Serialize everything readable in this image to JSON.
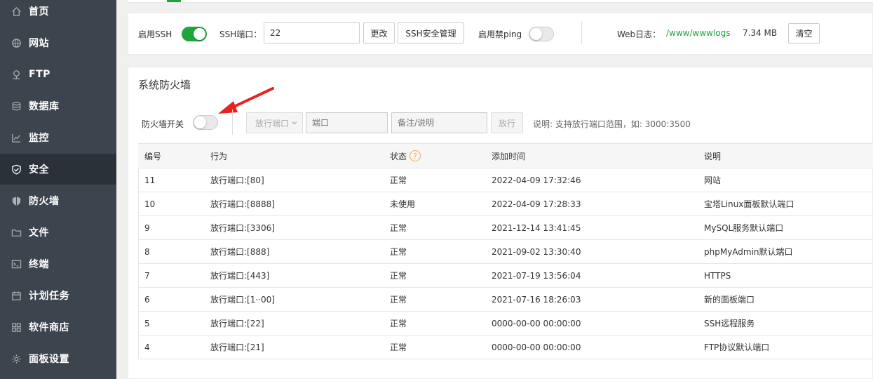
{
  "sidebar": {
    "items": [
      {
        "label": "首页",
        "icon": "home-icon"
      },
      {
        "label": "网站",
        "icon": "globe-icon"
      },
      {
        "label": "FTP",
        "icon": "ftp-icon"
      },
      {
        "label": "数据库",
        "icon": "database-icon"
      },
      {
        "label": "监控",
        "icon": "monitor-icon"
      },
      {
        "label": "安全",
        "icon": "shield-check-icon"
      },
      {
        "label": "防火墙",
        "icon": "shield-icon"
      },
      {
        "label": "文件",
        "icon": "folder-icon"
      },
      {
        "label": "终端",
        "icon": "terminal-icon"
      },
      {
        "label": "计划任务",
        "icon": "calendar-icon"
      },
      {
        "label": "软件商店",
        "icon": "grid-icon"
      },
      {
        "label": "面板设置",
        "icon": "gear-icon"
      }
    ],
    "active_index": 5
  },
  "ssh": {
    "enable_label": "启用SSH",
    "enabled": true,
    "port_label": "SSH端口：",
    "port_value": "22",
    "change_button": "更改",
    "manage_button": "SSH安全管理",
    "ping_label": "启用禁ping",
    "ping_enabled": false,
    "weblog_label": "Web日志：",
    "weblog_path": "/www/wwwlogs",
    "weblog_size": "7.34 MB",
    "clear_button": "清空"
  },
  "firewall": {
    "title": "系统防火墙",
    "switch_label": "防火墙开关",
    "switch_enabled": false,
    "select_value": "放行端口",
    "port_placeholder": "端口",
    "note_placeholder": "备注/说明",
    "allow_button": "放行",
    "hint": "说明: 支持放行端口范围，如: 3000:3500",
    "columns": [
      "编号",
      "行为",
      "状态",
      "添加时间",
      "说明"
    ],
    "rows": [
      {
        "id": "11",
        "action": "放行端口:[80]",
        "status": "正常",
        "time": "2022-04-09 17:32:46",
        "note": "网站"
      },
      {
        "id": "10",
        "action": "放行端口:[8888]",
        "status": "未使用",
        "time": "2022-04-09 17:28:33",
        "note": "宝塔Linux面板默认端口"
      },
      {
        "id": "9",
        "action": "放行端口:[3306]",
        "status": "正常",
        "time": "2021-12-14 13:41:45",
        "note": "MySQL服务默认端口"
      },
      {
        "id": "8",
        "action": "放行端口:[888]",
        "status": "正常",
        "time": "2021-09-02 13:30:40",
        "note": "phpMyAdmin默认端口"
      },
      {
        "id": "7",
        "action": "放行端口:[443]",
        "status": "正常",
        "time": "2021-07-19 13:56:04",
        "note": "HTTPS"
      },
      {
        "id": "6",
        "action": "放行端口:[1··00]",
        "status": "正常",
        "time": "2021-07-16 18:26:03",
        "note": "新的面板端口"
      },
      {
        "id": "5",
        "action": "放行端口:[22]",
        "status": "正常",
        "time": "0000-00-00 00:00:00",
        "note": "SSH远程服务"
      },
      {
        "id": "4",
        "action": "放行端口:[21]",
        "status": "正常",
        "time": "0000-00-00 00:00:00",
        "note": "FTP协议默认端口"
      }
    ]
  },
  "colors": {
    "sidebar_bg": "#3c444d",
    "sidebar_active": "#2a3138",
    "accent_green": "#20a53a",
    "arrow_red": "#e8231f"
  }
}
